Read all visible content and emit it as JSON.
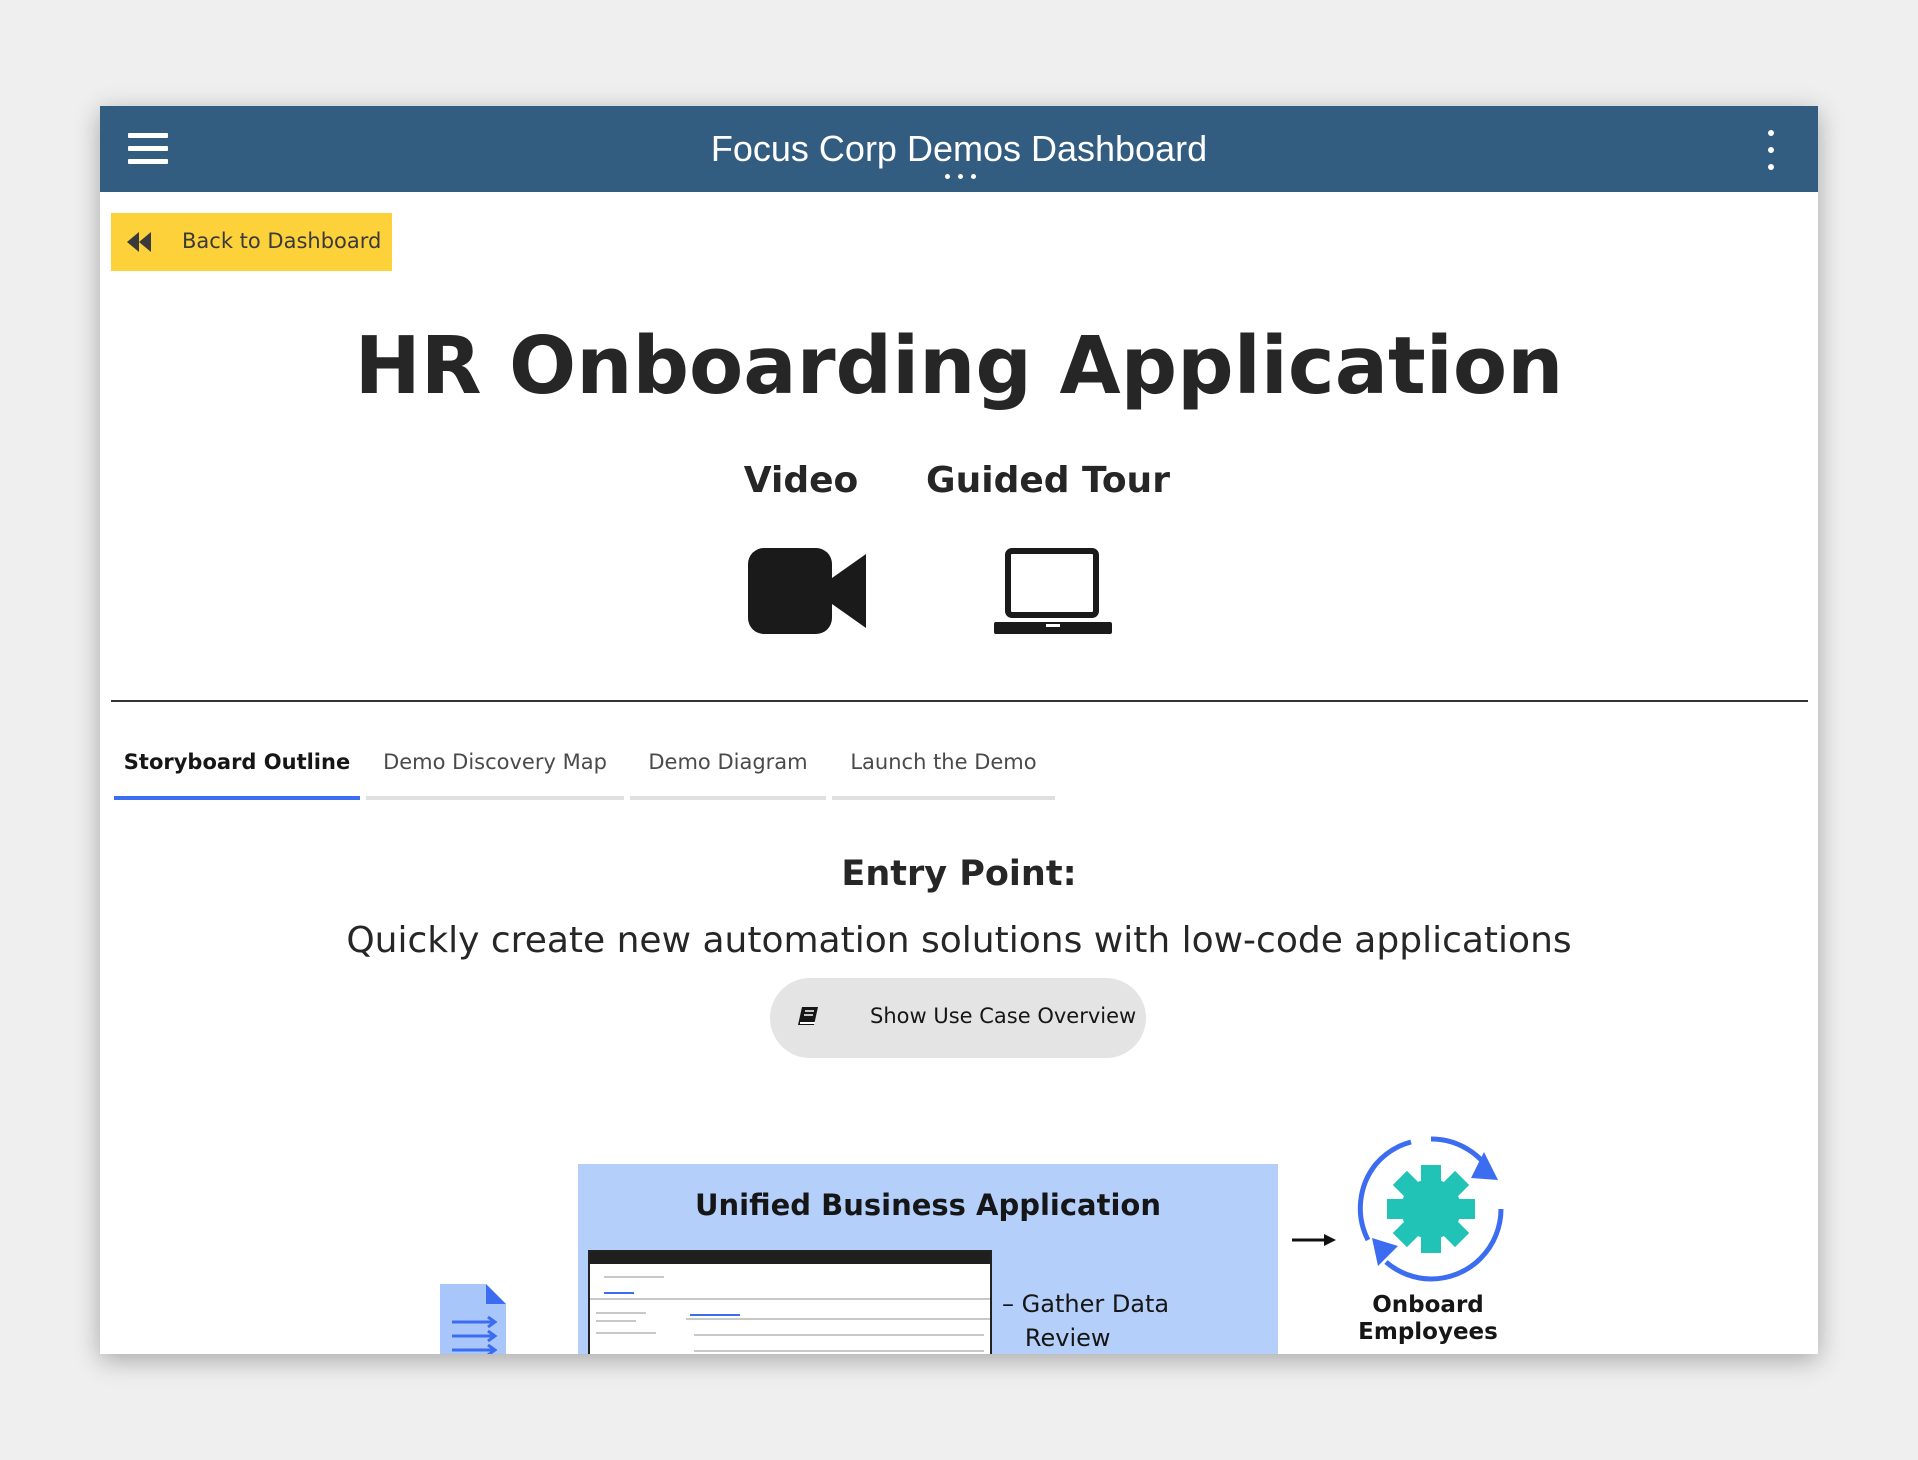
{
  "header": {
    "title": "Focus Corp Demos Dashboard",
    "menu_icon": "hamburger-menu-icon",
    "overflow_icon": "vertical-ellipsis-icon",
    "bg_color": "#335c81"
  },
  "back_button": {
    "label": "Back to Dashboard",
    "icon": "double-chevron-left-icon",
    "bg_color": "#fdd13a"
  },
  "page": {
    "title": "HR Onboarding Application"
  },
  "media": [
    {
      "label": "Video",
      "icon": "video-camera-icon"
    },
    {
      "label": "Guided Tour",
      "icon": "laptop-icon"
    }
  ],
  "tabs": [
    {
      "label": "Storyboard Outline",
      "active": true
    },
    {
      "label": "Demo Discovery Map",
      "active": false
    },
    {
      "label": "Demo Diagram",
      "active": false
    },
    {
      "label": "Launch the Demo",
      "active": false
    }
  ],
  "entry": {
    "title": "Entry Point:",
    "subtitle": "Quickly create new automation solutions with low-code applications",
    "button_label": "Show Use Case Overview",
    "button_icon": "book-icon"
  },
  "diagram": {
    "panel_title": "Unified Business Application",
    "bullets": [
      "Gather Data",
      "Review"
    ],
    "result_label": "Onboard Employees",
    "result_icon": "gear-cycle-icon",
    "input_icon": "document-icon",
    "accent_color": "#b5cffb",
    "gear_color": "#20c3b6",
    "cycle_color": "#3c6df0"
  }
}
